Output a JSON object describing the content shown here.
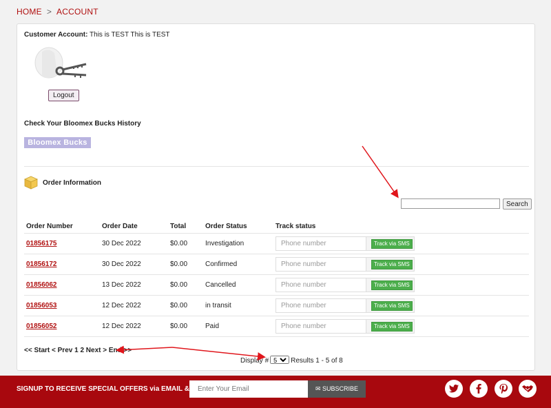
{
  "breadcrumb": {
    "home": "HOME",
    "sep": ">",
    "current": "ACCOUNT"
  },
  "account": {
    "label": "Customer Account:",
    "name": "This is TEST This is TEST",
    "logout": "Logout"
  },
  "bucks": {
    "title": "Check Your Bloomex Bucks History",
    "button": "Bloomex Bucks"
  },
  "orders": {
    "title": "Order Information",
    "search_button": "Search",
    "search_value": "",
    "columns": [
      "Order Number",
      "Order Date",
      "Total",
      "Order Status",
      "Track status"
    ],
    "phone_placeholder": "Phone number",
    "sms_label": "Track via SMS",
    "rows": [
      {
        "number": "01856175",
        "date": "30 Dec 2022",
        "total": "$0.00",
        "status": "Investigation"
      },
      {
        "number": "01856172",
        "date": "30 Dec 2022",
        "total": "$0.00",
        "status": "Confirmed"
      },
      {
        "number": "01856062",
        "date": "13 Dec 2022",
        "total": "$0.00",
        "status": "Cancelled"
      },
      {
        "number": "01856053",
        "date": "12 Dec 2022",
        "total": "$0.00",
        "status": "in transit"
      },
      {
        "number": "01856052",
        "date": "12 Dec 2022",
        "total": "$0.00",
        "status": "Paid"
      }
    ]
  },
  "pagination": {
    "text": "<< Start < Prev 1 2 Next > End >>",
    "display_label": "Display #",
    "display_value": "5",
    "results": "Results 1 - 5 of 8"
  },
  "footer": {
    "signup": "SIGNUP TO RECEIVE SPECIAL OFFERS via EMAIL & SMS",
    "email_placeholder": "Enter Your Email",
    "subscribe": "SUBSCRIBE",
    "social": [
      "twitter-icon",
      "facebook-icon",
      "pinterest-icon",
      "handshake-icon"
    ]
  },
  "colors": {
    "brand_red": "#a8080e",
    "link_red": "#b01010",
    "sms_green": "#4cae4c",
    "bucks_purple": "#b9b4e0"
  }
}
